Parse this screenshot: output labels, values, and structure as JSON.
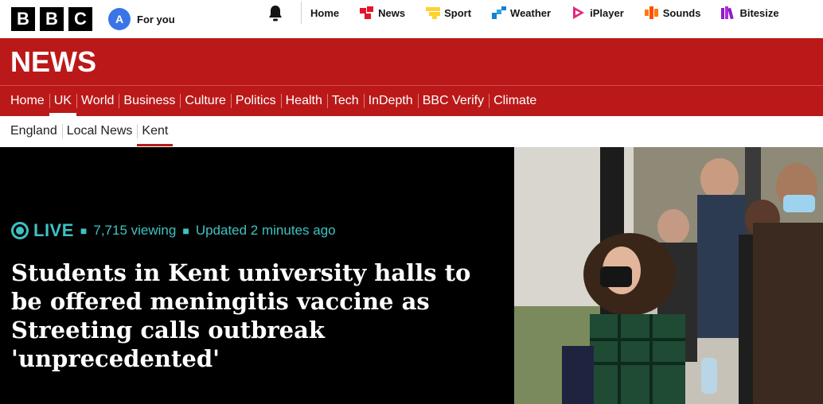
{
  "brand": {
    "letters": [
      "B",
      "B",
      "C"
    ]
  },
  "account": {
    "initial": "A",
    "label": "For you"
  },
  "topnav": [
    {
      "label": "Home",
      "icon": "none"
    },
    {
      "label": "News",
      "icon": "news-icon"
    },
    {
      "label": "Sport",
      "icon": "sport-icon"
    },
    {
      "label": "Weather",
      "icon": "weather-icon"
    },
    {
      "label": "iPlayer",
      "icon": "iplayer-icon"
    },
    {
      "label": "Sounds",
      "icon": "sounds-icon"
    },
    {
      "label": "Bitesize",
      "icon": "bitesize-icon"
    }
  ],
  "section_title": "NEWS",
  "nav": [
    "Home",
    "UK",
    "World",
    "Business",
    "Culture",
    "Politics",
    "Health",
    "Tech",
    "InDepth",
    "BBC Verify",
    "Climate"
  ],
  "nav_active": "UK",
  "subnav": [
    "England",
    "Local News",
    "Kent"
  ],
  "subnav_active": "Kent",
  "hero": {
    "live_label": "LIVE",
    "viewing": "7,715 viewing",
    "updated": "Updated 2 minutes ago",
    "headline": "Students in Kent university halls to be offered meningitis vaccine as Streeting calls outbreak 'unprecedented'"
  },
  "colors": {
    "brand_red": "#bb1919",
    "live_teal": "#3fc1c2",
    "avatar_blue": "#3a75e6"
  }
}
